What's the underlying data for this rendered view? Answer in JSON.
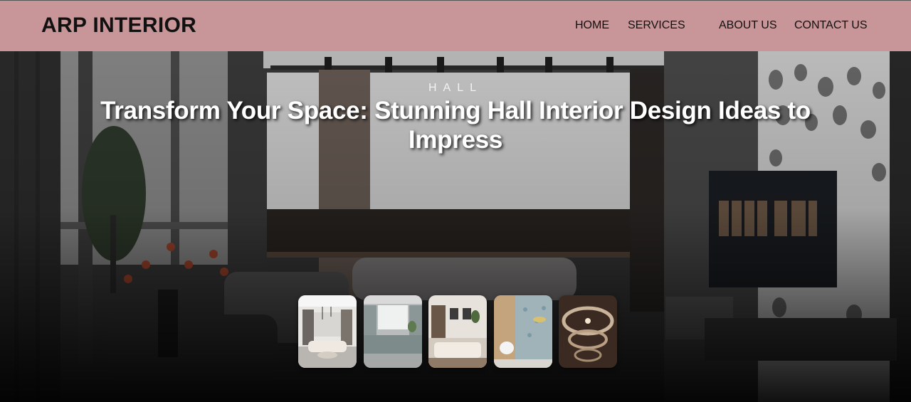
{
  "brand": {
    "name": "ARP INTERIOR"
  },
  "nav": {
    "items": [
      {
        "label": "HOME"
      },
      {
        "label": "SERVICES"
      },
      {
        "label": "ABOUT US"
      },
      {
        "label": "CONTACT US"
      }
    ]
  },
  "hero": {
    "kicker": "HALL",
    "headline": "Transform Your Space: Stunning Hall Interior Design Ideas to Impress",
    "thumbnails": [
      {
        "icon": "living-room-thumbnail"
      },
      {
        "icon": "kitchen-thumbnail"
      },
      {
        "icon": "bedroom-thumbnail"
      },
      {
        "icon": "bathroom-thumbnail"
      },
      {
        "icon": "ceiling-thumbnail"
      }
    ]
  },
  "colors": {
    "header_bg": "#c89598",
    "text_dark": "#111111",
    "hero_text": "#ffffff"
  }
}
